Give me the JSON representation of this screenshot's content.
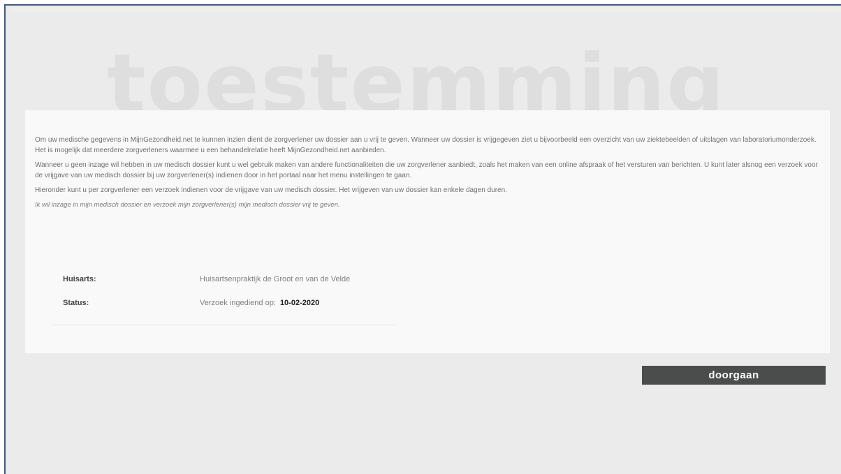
{
  "page": {
    "heading": "toestemming"
  },
  "intro": {
    "paragraph1": "Om uw medische gegevens in MijnGezondheid.net te kunnen inzien dient de zorgverlener uw dossier aan u vrij te geven. Wanneer uw dossier is vrijgegeven ziet u bijvoorbeeld een overzicht van uw ziektebeelden of uitslagen van laboratoriumonderzoek. Het is mogelijk dat meerdere zorgverleners waarmee u een behandelrelatie heeft MijnGezondheid.net aanbieden.",
    "paragraph2": "Wanneer u geen inzage wil hebben in uw medisch dossier kunt u wel gebruik maken van andere functionaliteiten die uw zorgverlener aanbiedt, zoals het maken van een online afspraak of het versturen van berichten. U kunt later alsnog een verzoek voor de vrijgave van uw medisch dossier bij uw zorgverlener(s) indienen door in het portaal naar het menu instellingen te gaan.",
    "paragraph3": "Hieronder kunt u per zorgverlener een verzoek indienen voor de vrijgave van uw medisch dossier. Het vrijgeven van uw dossier kan enkele dagen duren.",
    "consent": "Ik wil inzage in mijn medisch dossier en verzoek mijn zorgverlener(s) mijn medisch dossier vrij te geven."
  },
  "details": {
    "huisarts_label": "Huisarts:",
    "huisarts_value": "Huisartsenpraktijk de Groot en van de Velde",
    "status_label": "Status:",
    "status_text": "Verzoek ingediend op:",
    "status_date": "10-02-2020"
  },
  "actions": {
    "continue_label": "doorgaan"
  },
  "colors": {
    "background": "#ebebeb",
    "card": "#f9f9f9",
    "button": "#4a4d4b",
    "frame_border": "#3d5a8c"
  }
}
